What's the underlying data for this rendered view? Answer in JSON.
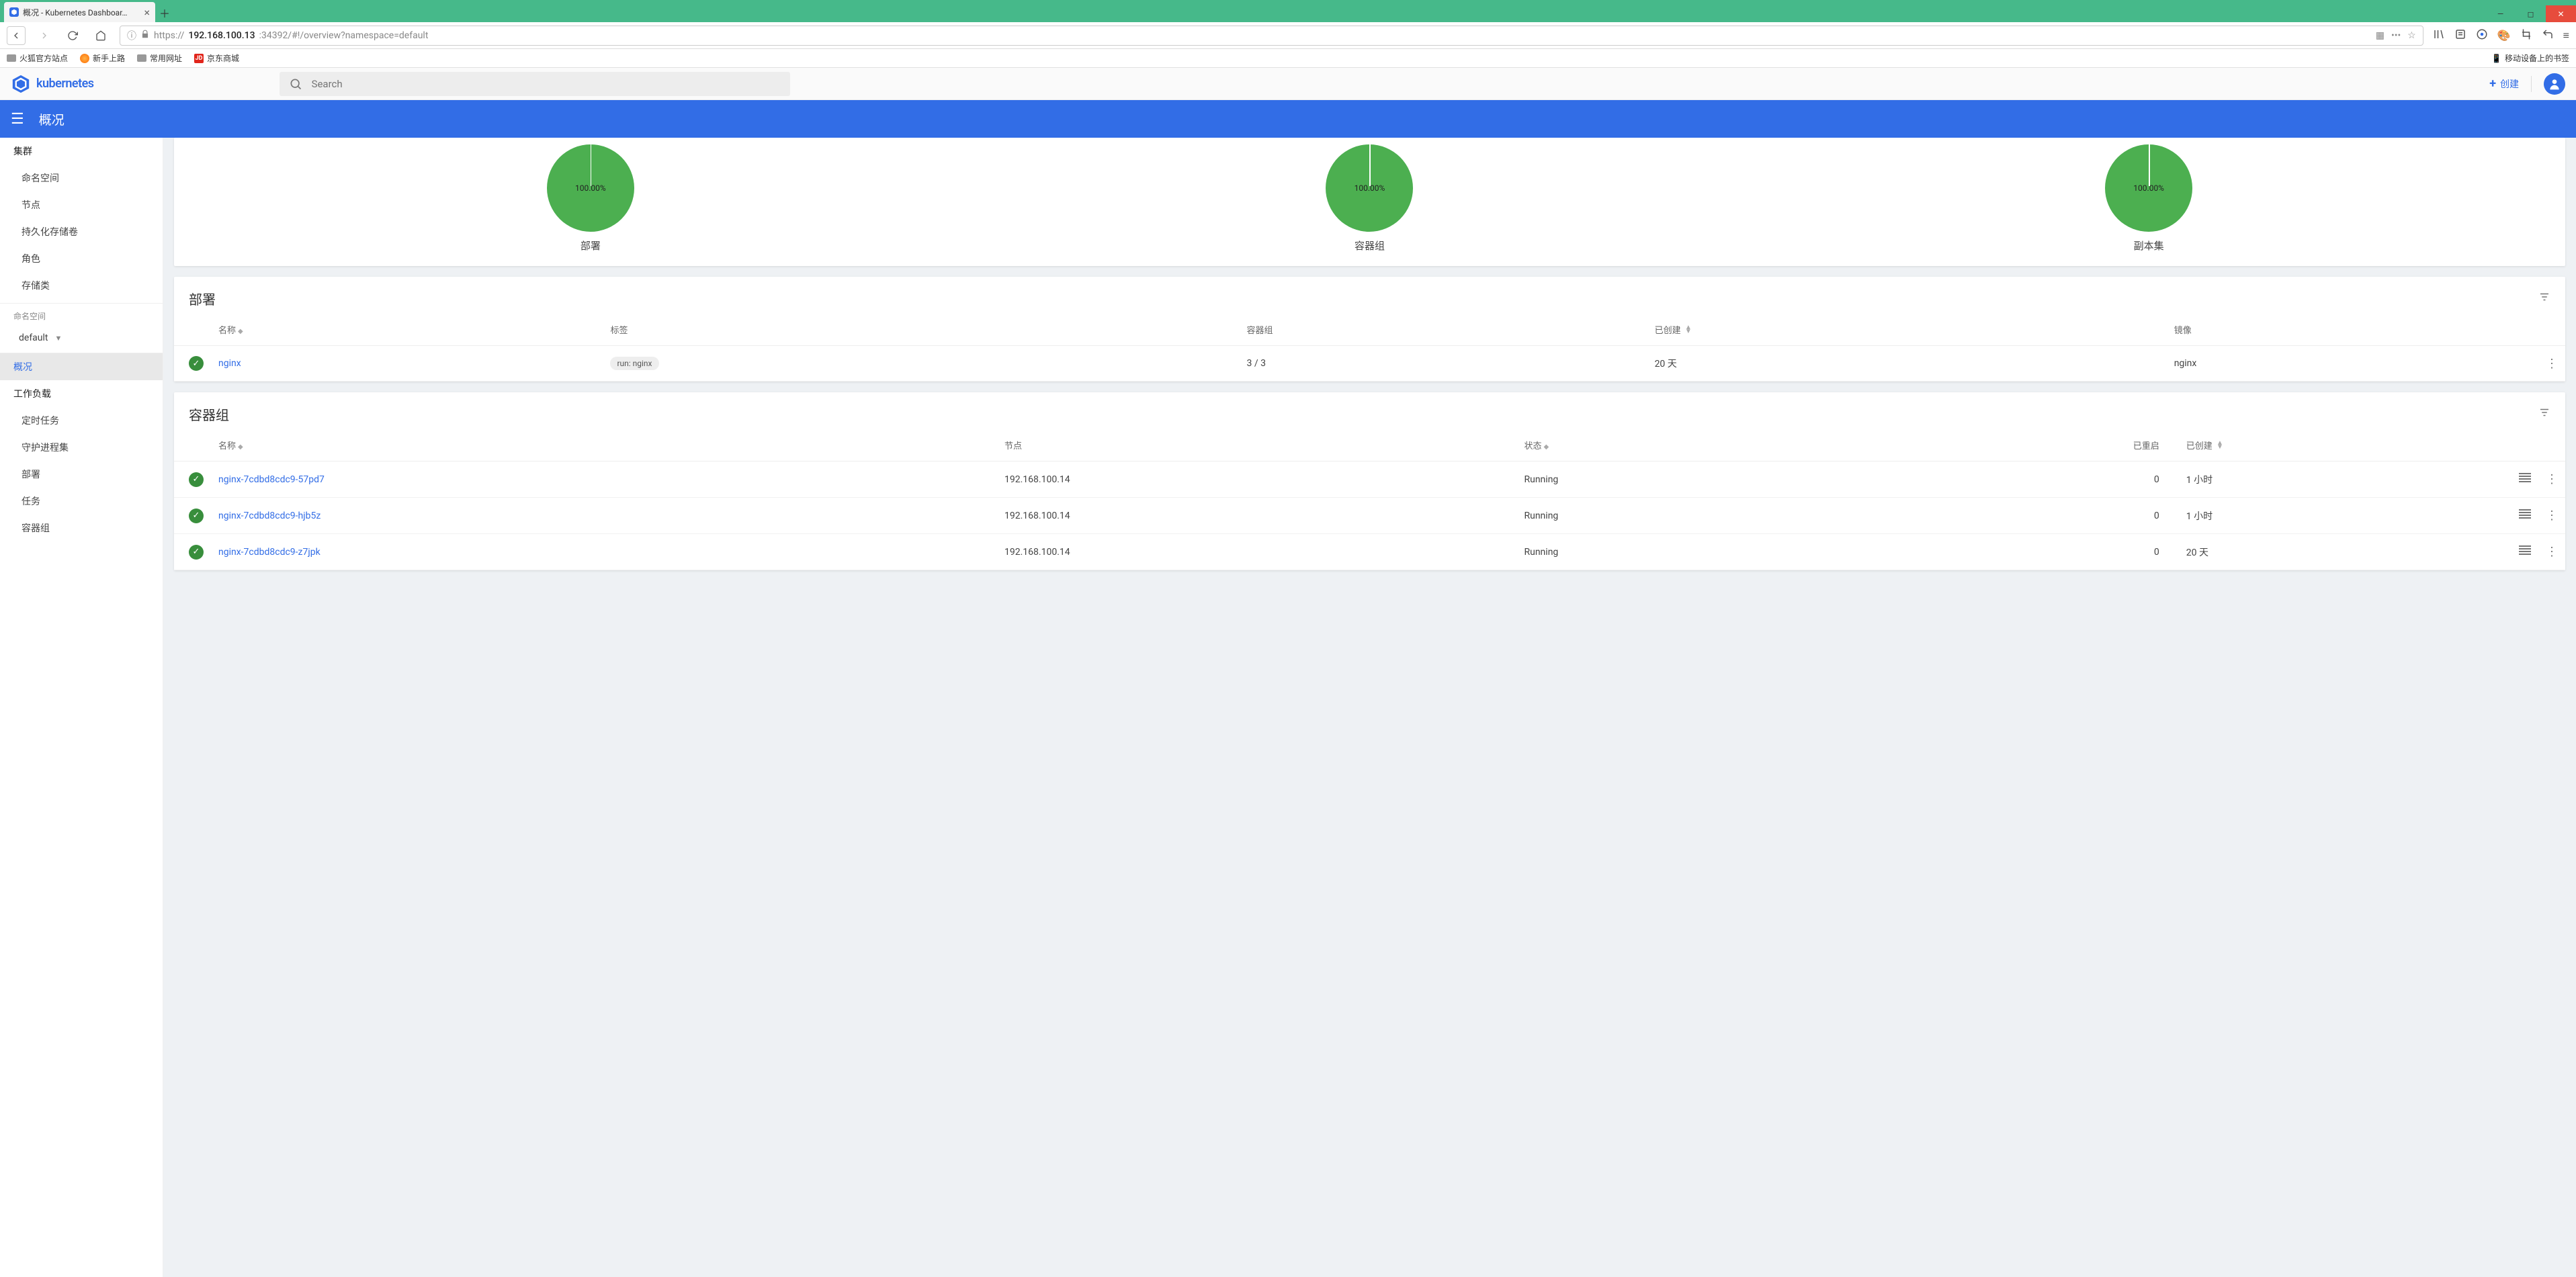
{
  "browser": {
    "tab_title": "概况 - Kubernetes Dashboar…",
    "url_proto": "https://",
    "url_host": "192.168.100.13",
    "url_port_path": ":34392/#!/overview?namespace=default",
    "bookmarks": [
      "火狐官方站点",
      "新手上路",
      "常用网址",
      "京东商城"
    ],
    "mobile_bookmarks": "移动设备上的书签"
  },
  "header": {
    "brand": "kubernetes",
    "search_placeholder": "Search",
    "create_label": "创建"
  },
  "bluebar": {
    "title": "概况"
  },
  "sidebar": {
    "cluster_heading": "集群",
    "cluster_items": [
      "命名空间",
      "节点",
      "持久化存储卷",
      "角色",
      "存储类"
    ],
    "ns_heading": "命名空间",
    "ns_selected": "default",
    "overview": "概况",
    "workloads_heading": "工作负载",
    "workload_items": [
      "定时任务",
      "守护进程集",
      "部署",
      "任务",
      "容器组"
    ]
  },
  "charts": [
    {
      "percent": "100.00%",
      "label": "部署"
    },
    {
      "percent": "100.00%",
      "label": "容器组"
    },
    {
      "percent": "100.00%",
      "label": "副本集"
    }
  ],
  "deployments": {
    "title": "部署",
    "cols": {
      "name": "名称",
      "labels": "标签",
      "pods": "容器组",
      "created": "已创建",
      "images": "镜像"
    },
    "rows": [
      {
        "name": "nginx",
        "label": "run: nginx",
        "pods": "3 / 3",
        "created": "20 天",
        "image": "nginx"
      }
    ]
  },
  "pods": {
    "title": "容器组",
    "cols": {
      "name": "名称",
      "node": "节点",
      "status": "状态",
      "restarts": "已重启",
      "created": "已创建"
    },
    "rows": [
      {
        "name": "nginx-7cdbd8cdc9-57pd7",
        "node": "192.168.100.14",
        "status": "Running",
        "restarts": "0",
        "created": "1 小时"
      },
      {
        "name": "nginx-7cdbd8cdc9-hjb5z",
        "node": "192.168.100.14",
        "status": "Running",
        "restarts": "0",
        "created": "1 小时"
      },
      {
        "name": "nginx-7cdbd8cdc9-z7jpk",
        "node": "192.168.100.14",
        "status": "Running",
        "restarts": "0",
        "created": "20 天"
      }
    ]
  }
}
